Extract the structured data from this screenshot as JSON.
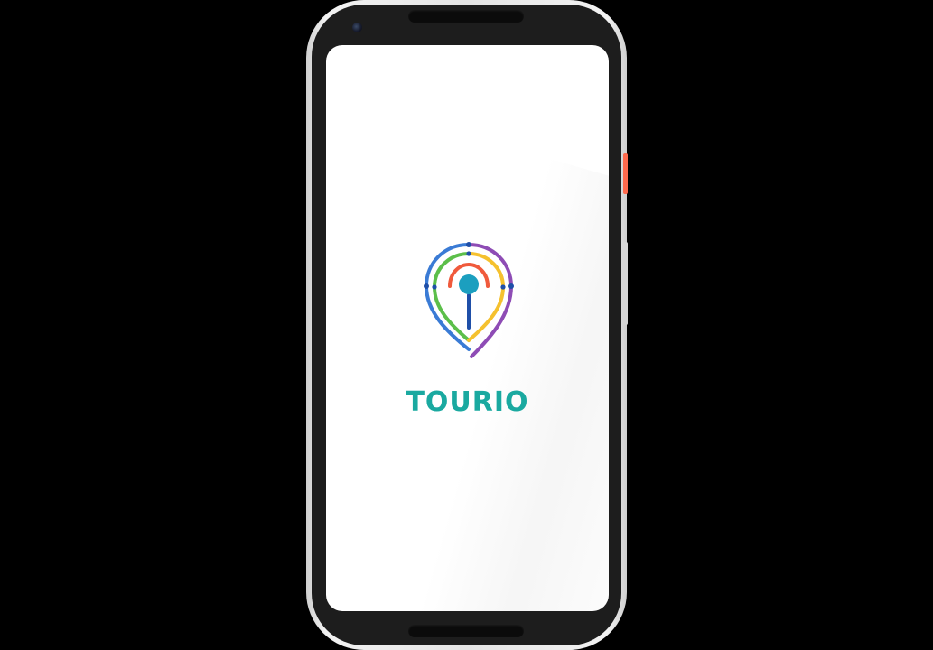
{
  "app": {
    "brand_name": "TOURIO",
    "brand_color": "#1aa9a0"
  },
  "splash": {
    "logo_icon": "location-pin-icon",
    "ring_colors": [
      "#8e4cb5",
      "#3a7bd5",
      "#5cbf4a",
      "#f5c12e",
      "#f05a3c",
      "#1f4fa8"
    ],
    "dot_color": "#1b9fbf"
  },
  "device": {
    "power_button_color": "#ff6a4d"
  }
}
